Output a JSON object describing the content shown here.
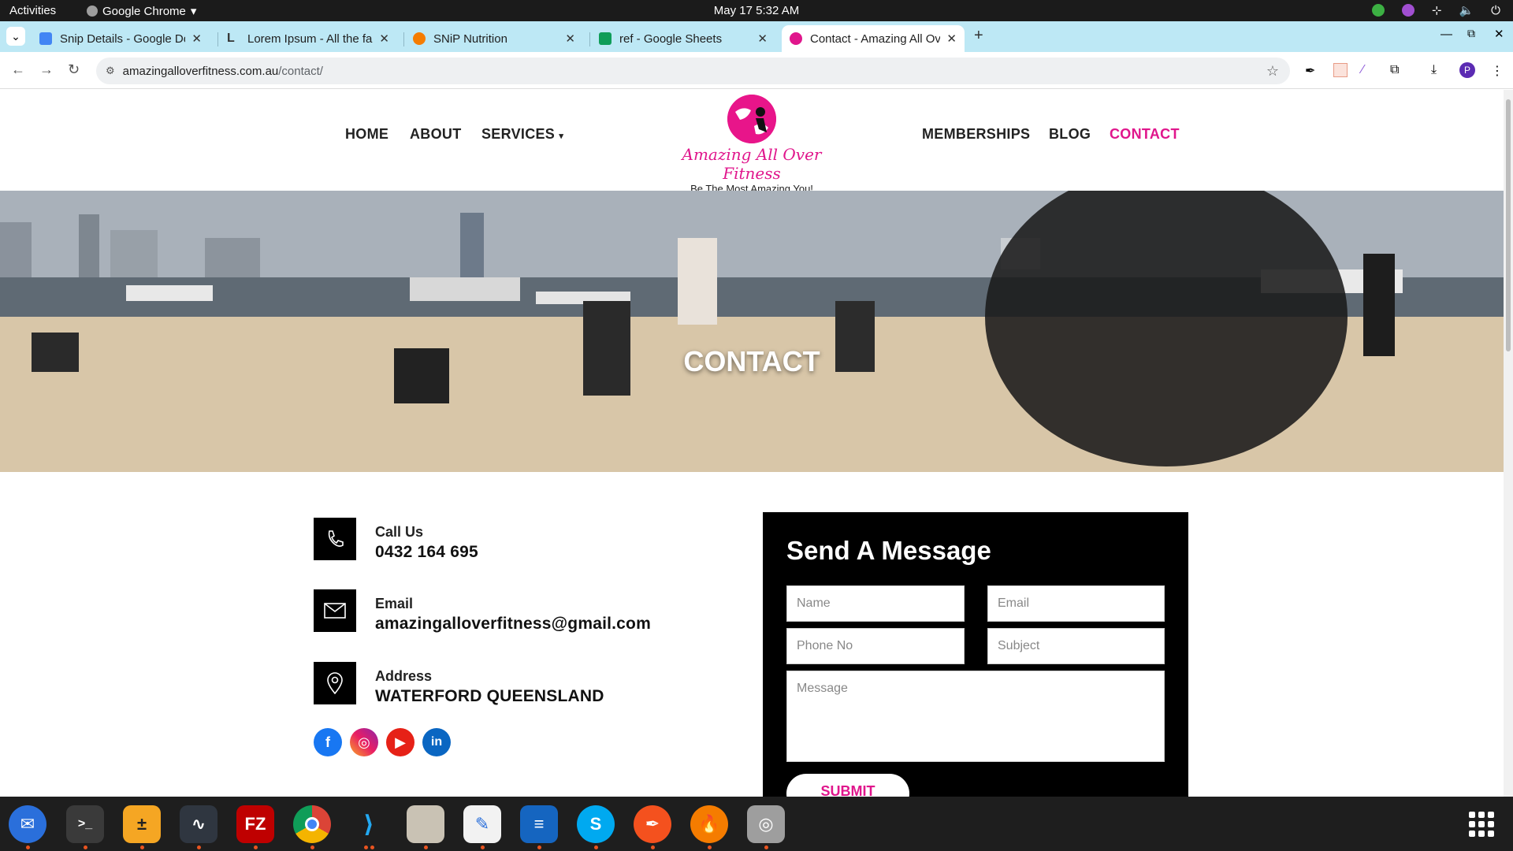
{
  "system": {
    "activities": "Activities",
    "app_name": "Google Chrome",
    "clock": "May 17  5:32 AM"
  },
  "tabs": [
    {
      "title": "Snip Details - Google Do",
      "icon": "google-docs-icon",
      "color": "#4285f4"
    },
    {
      "title": "Lorem Ipsum - All the fac",
      "icon": "lorem-ipsum-icon",
      "color": "#333333"
    },
    {
      "title": "SNiP Nutrition",
      "icon": "snip-nutrition-icon",
      "color": "#f57c00"
    },
    {
      "title": "ref - Google Sheets",
      "icon": "google-sheets-icon",
      "color": "#0f9d58"
    },
    {
      "title": "Contact - Amazing All Ov",
      "icon": "site-favicon",
      "color": "#e0168c"
    }
  ],
  "address": {
    "host": "amazingalloverfitness.com.au",
    "path": "/contact/"
  },
  "site": {
    "nav_left": [
      "HOME",
      "ABOUT",
      "SERVICES"
    ],
    "nav_right": [
      "MEMBERSHIPS",
      "BLOG",
      "CONTACT"
    ],
    "logo_name": "Amazing All Over Fitness",
    "logo_tagline": "Be The Most Amazing You!",
    "hero_title": "CONTACT",
    "brand_color": "#e0168c"
  },
  "contact": {
    "call_label": "Call Us",
    "call_value": "0432 164 695",
    "email_label": "Email",
    "email_value": "amazingalloverfitness@gmail.com",
    "address_label": "Address",
    "address_value": "WATERFORD QUEENSLAND"
  },
  "social": [
    "facebook-icon",
    "instagram-icon",
    "youtube-icon",
    "linkedin-icon"
  ],
  "form": {
    "title": "Send A Message",
    "name_placeholder": "Name",
    "email_placeholder": "Email",
    "phone_placeholder": "Phone No",
    "subject_placeholder": "Subject",
    "message_placeholder": "Message",
    "submit_label": "SUBMIT"
  }
}
